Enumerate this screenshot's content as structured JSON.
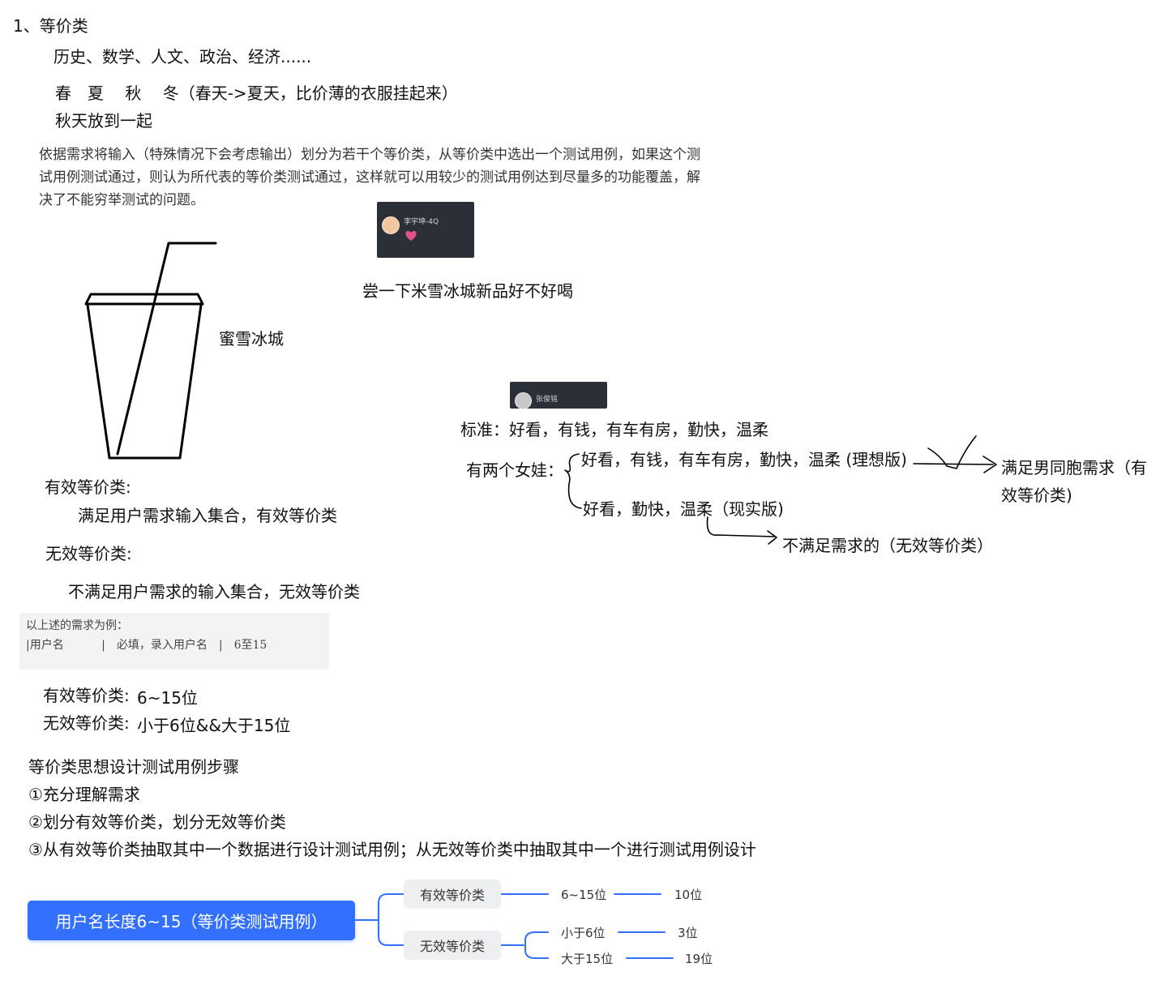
{
  "heading": "1、等价类",
  "subjects": "历史、数学、人文、政治、经济......",
  "seasons_line1": "春　夏　 秋　 冬（春天->夏天，比价薄的衣服挂起来）",
  "seasons_line2": "秋天放到一起",
  "definition": "依据需求将输入（特殊情况下会考虑输出）划分为若干个等价类，从等价类中选出一个测试用例，如果这个测试用例测试通过，则认为所代表的等价类测试通过，这样就可以用较少的测试用例达到尽量多的功能覆盖，解决了不能穷举测试的问题。",
  "card1": {
    "username": "李宇坤-4Q",
    "icon": "heart-icon",
    "accent": "#e0528a"
  },
  "tasting_caption": "尝一下米雪冰城新品好不好喝",
  "cup_label": "蜜雪冰城",
  "card2": {
    "username": "张俊铭"
  },
  "standard_line": "标准：好看，有钱，有车有房，勤快，温柔",
  "two_girls": "有两个女娃：",
  "girl_ideal": "好看，有钱，有车有房，勤快，温柔 (理想版)",
  "girl_real": "好看，勤快，温柔（现实版)",
  "satisfies": "满足男同胞需求（有效等价类)",
  "not_satisfies": "不满足需求的（无效等价类）",
  "valid_class_label": "有效等价类:",
  "valid_class_desc": "满足用户需求输入集合，有效等价类",
  "invalid_class_label": "无效等价类:",
  "invalid_class_desc": "不满足用户需求的输入集合，无效等价类",
  "example_box": {
    "line1": "以上述的需求为例：",
    "line2": "|用户名　　　 |　必填，录入用户名　|　6至15"
  },
  "valid_example_label": "有效等价类:",
  "valid_example_value": "6~15位",
  "invalid_example_label": "无效等价类:",
  "invalid_example_value": "小于6位&&大于15位",
  "steps": {
    "title": "等价类思想设计测试用例步骤",
    "step1": "①充分理解需求",
    "step2": "②划分有效等价类，划分无效等价类",
    "step3": "③从有效等价类抽取其中一个数据进行设计测试用例；从无效等价类中抽取其中一个进行测试用例设计"
  },
  "mindmap": {
    "root": "用户名长度6~15（等价类测试用例）",
    "root_color": "#3370ff",
    "valid": {
      "label": "有效等价类",
      "range": "6~15位",
      "sample": "10位"
    },
    "invalid": {
      "label": "无效等价类",
      "low": {
        "range": "小于6位",
        "sample": "3位"
      },
      "high": {
        "range": "大于15位",
        "sample": "19位"
      }
    }
  }
}
